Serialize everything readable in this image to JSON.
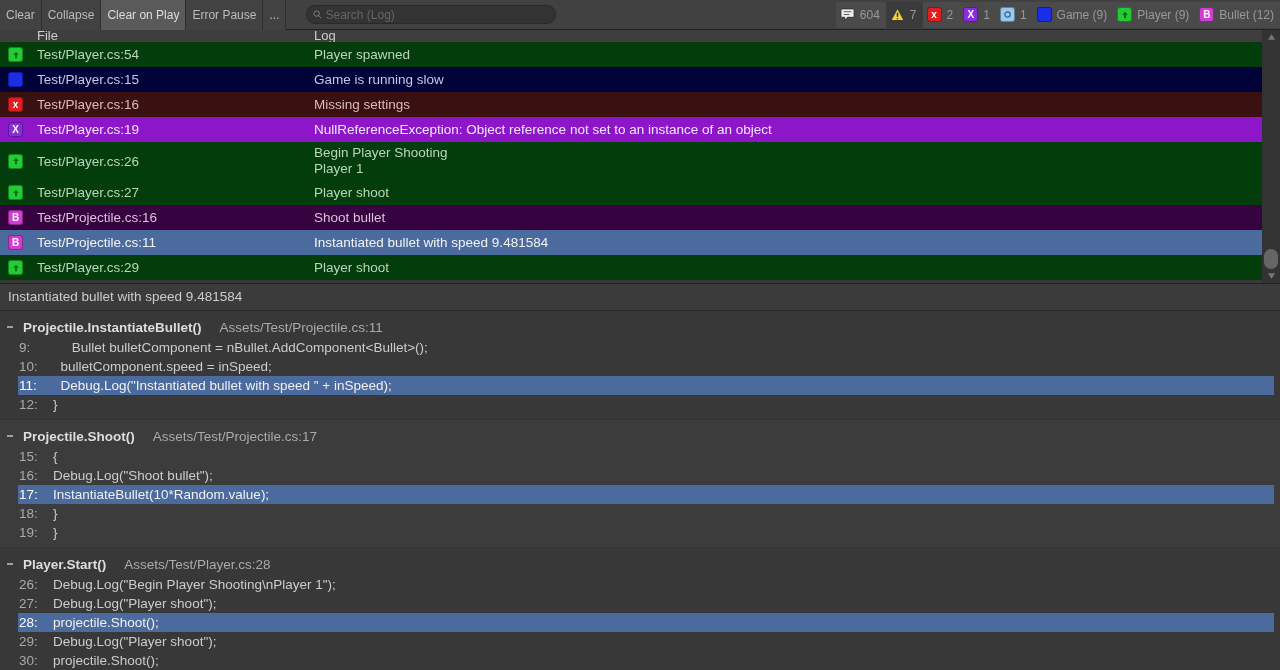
{
  "toolbar": {
    "buttons": [
      {
        "label": "Clear",
        "on": false
      },
      {
        "label": "Collapse",
        "on": false
      },
      {
        "label": "Clear on Play",
        "on": true
      },
      {
        "label": "Error Pause",
        "on": false
      },
      {
        "label": "...",
        "on": false
      }
    ],
    "search": {
      "placeholder": "Search (Log)"
    },
    "filters": [
      {
        "kind": "message",
        "label": "604",
        "on": true
      },
      {
        "kind": "warning",
        "label": "7",
        "on": false
      },
      {
        "kind": "error",
        "glyph": "x",
        "label": "2",
        "on": true
      },
      {
        "kind": "exception",
        "glyph": "X",
        "label": "1",
        "on": true
      },
      {
        "kind": "assert",
        "label": "1",
        "on": true
      },
      {
        "kind": "game",
        "label": "Game (9)",
        "on": true
      },
      {
        "kind": "player",
        "label": "Player (9)",
        "on": true
      },
      {
        "kind": "bullet",
        "glyph": "B",
        "label": "Bullet (12)",
        "on": true
      }
    ]
  },
  "table": {
    "columns": [
      "File",
      "Log"
    ],
    "rows": [
      {
        "kind": "player",
        "file": "Test/Player.cs:54",
        "log": [
          "Player spawned"
        ],
        "selected": false
      },
      {
        "kind": "game",
        "file": "Test/Player.cs:15",
        "log": [
          "Game is running slow"
        ],
        "selected": false
      },
      {
        "kind": "error",
        "glyph": "x",
        "file": "Test/Player.cs:16",
        "log": [
          "Missing settings"
        ],
        "selected": false
      },
      {
        "kind": "exception",
        "glyph": "X",
        "file": "Test/Player.cs:19",
        "log": [
          "NullReferenceException: Object reference not set to an instance of an object"
        ],
        "selected": false
      },
      {
        "kind": "player",
        "file": "Test/Player.cs:26",
        "log": [
          "Begin Player Shooting",
          "Player 1"
        ],
        "selected": false
      },
      {
        "kind": "player",
        "file": "Test/Player.cs:27",
        "log": [
          "Player shoot"
        ],
        "selected": false
      },
      {
        "kind": "bullet",
        "glyph": "B",
        "file": "Test/Projectile.cs:16",
        "log": [
          "Shoot bullet"
        ],
        "selected": false
      },
      {
        "kind": "bullet",
        "glyph": "B",
        "file": "Test/Projectile.cs:11",
        "log": [
          "Instantiated bullet with speed 9.481584"
        ],
        "selected": true
      },
      {
        "kind": "player",
        "file": "Test/Player.cs:29",
        "log": [
          "Player shoot"
        ],
        "selected": false
      }
    ]
  },
  "message": "Instantiated bullet with speed 9.481584",
  "stack": [
    {
      "method": "Projectile.InstantiateBullet()",
      "path": "Assets/Test/Projectile.cs:11",
      "expanded": true,
      "lines": [
        {
          "number": "9:",
          "code": "     Bullet bulletComponent = nBullet.AddComponent<Bullet>();",
          "selected": false
        },
        {
          "number": "10:",
          "code": "  bulletComponent.speed = inSpeed;",
          "selected": false
        },
        {
          "number": "11:",
          "code": "  Debug.Log(\"Instantiated bullet with speed \" + inSpeed);",
          "selected": true
        },
        {
          "number": "12:",
          "code": "}",
          "selected": false
        }
      ]
    },
    {
      "method": "Projectile.Shoot()",
      "path": "Assets/Test/Projectile.cs:17",
      "expanded": true,
      "lines": [
        {
          "number": "15:",
          "code": "{",
          "selected": false
        },
        {
          "number": "16:",
          "code": "Debug.Log(\"Shoot bullet\");",
          "selected": false
        },
        {
          "number": "17:",
          "code": "InstantiateBullet(10*Random.value);",
          "selected": true
        },
        {
          "number": "18:",
          "code": "}",
          "selected": false
        },
        {
          "number": "19:",
          "code": "}",
          "selected": false
        }
      ]
    },
    {
      "method": "Player.Start()",
      "path": "Assets/Test/Player.cs:28",
      "expanded": true,
      "lines": [
        {
          "number": "26:",
          "code": "Debug.Log(\"Begin Player Shooting\\nPlayer 1\");",
          "selected": false
        },
        {
          "number": "27:",
          "code": "Debug.Log(\"Player shoot\");",
          "selected": false
        },
        {
          "number": "28:",
          "code": "projectile.Shoot();",
          "selected": true
        },
        {
          "number": "29:",
          "code": "Debug.Log(\"Player shoot\");",
          "selected": false
        },
        {
          "number": "30:",
          "code": "projectile.Shoot();",
          "selected": false
        }
      ]
    }
  ]
}
